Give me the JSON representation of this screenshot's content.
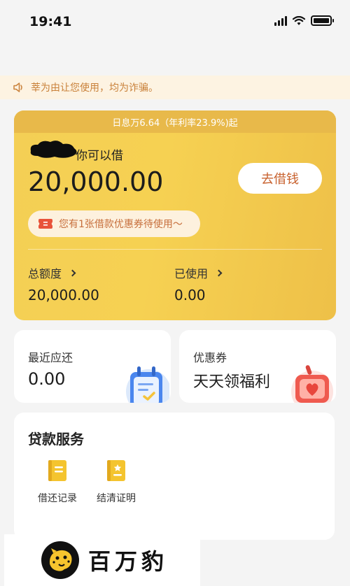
{
  "status_bar": {
    "time": "19:41"
  },
  "notice": {
    "text": "莘为由让您使用，均为诈骗。"
  },
  "loan_card": {
    "banner": "日息万6.64（年利率23.9%)起",
    "borrow_label": "你可以借",
    "amount": "20,000.00",
    "borrow_button": "去借钱",
    "coupon_text": "您有1张借款优惠券待使用～",
    "total_label": "总额度",
    "total_value": "20,000.00",
    "used_label": "已使用",
    "used_value": "0.00"
  },
  "recent_repay": {
    "title": "最近应还",
    "value": "0.00"
  },
  "coupons": {
    "title": "优惠券",
    "value": "天天领福利"
  },
  "services": {
    "title": "贷款服务",
    "items": [
      {
        "label": "借还记录",
        "icon": "document-icon"
      },
      {
        "label": "结清证明",
        "icon": "certificate-icon"
      }
    ]
  },
  "watermark": {
    "text": "百万豹"
  },
  "colors": {
    "accent": "#f4cf55",
    "button_text": "#c8622f",
    "notice_bg": "#fdf3e2"
  }
}
